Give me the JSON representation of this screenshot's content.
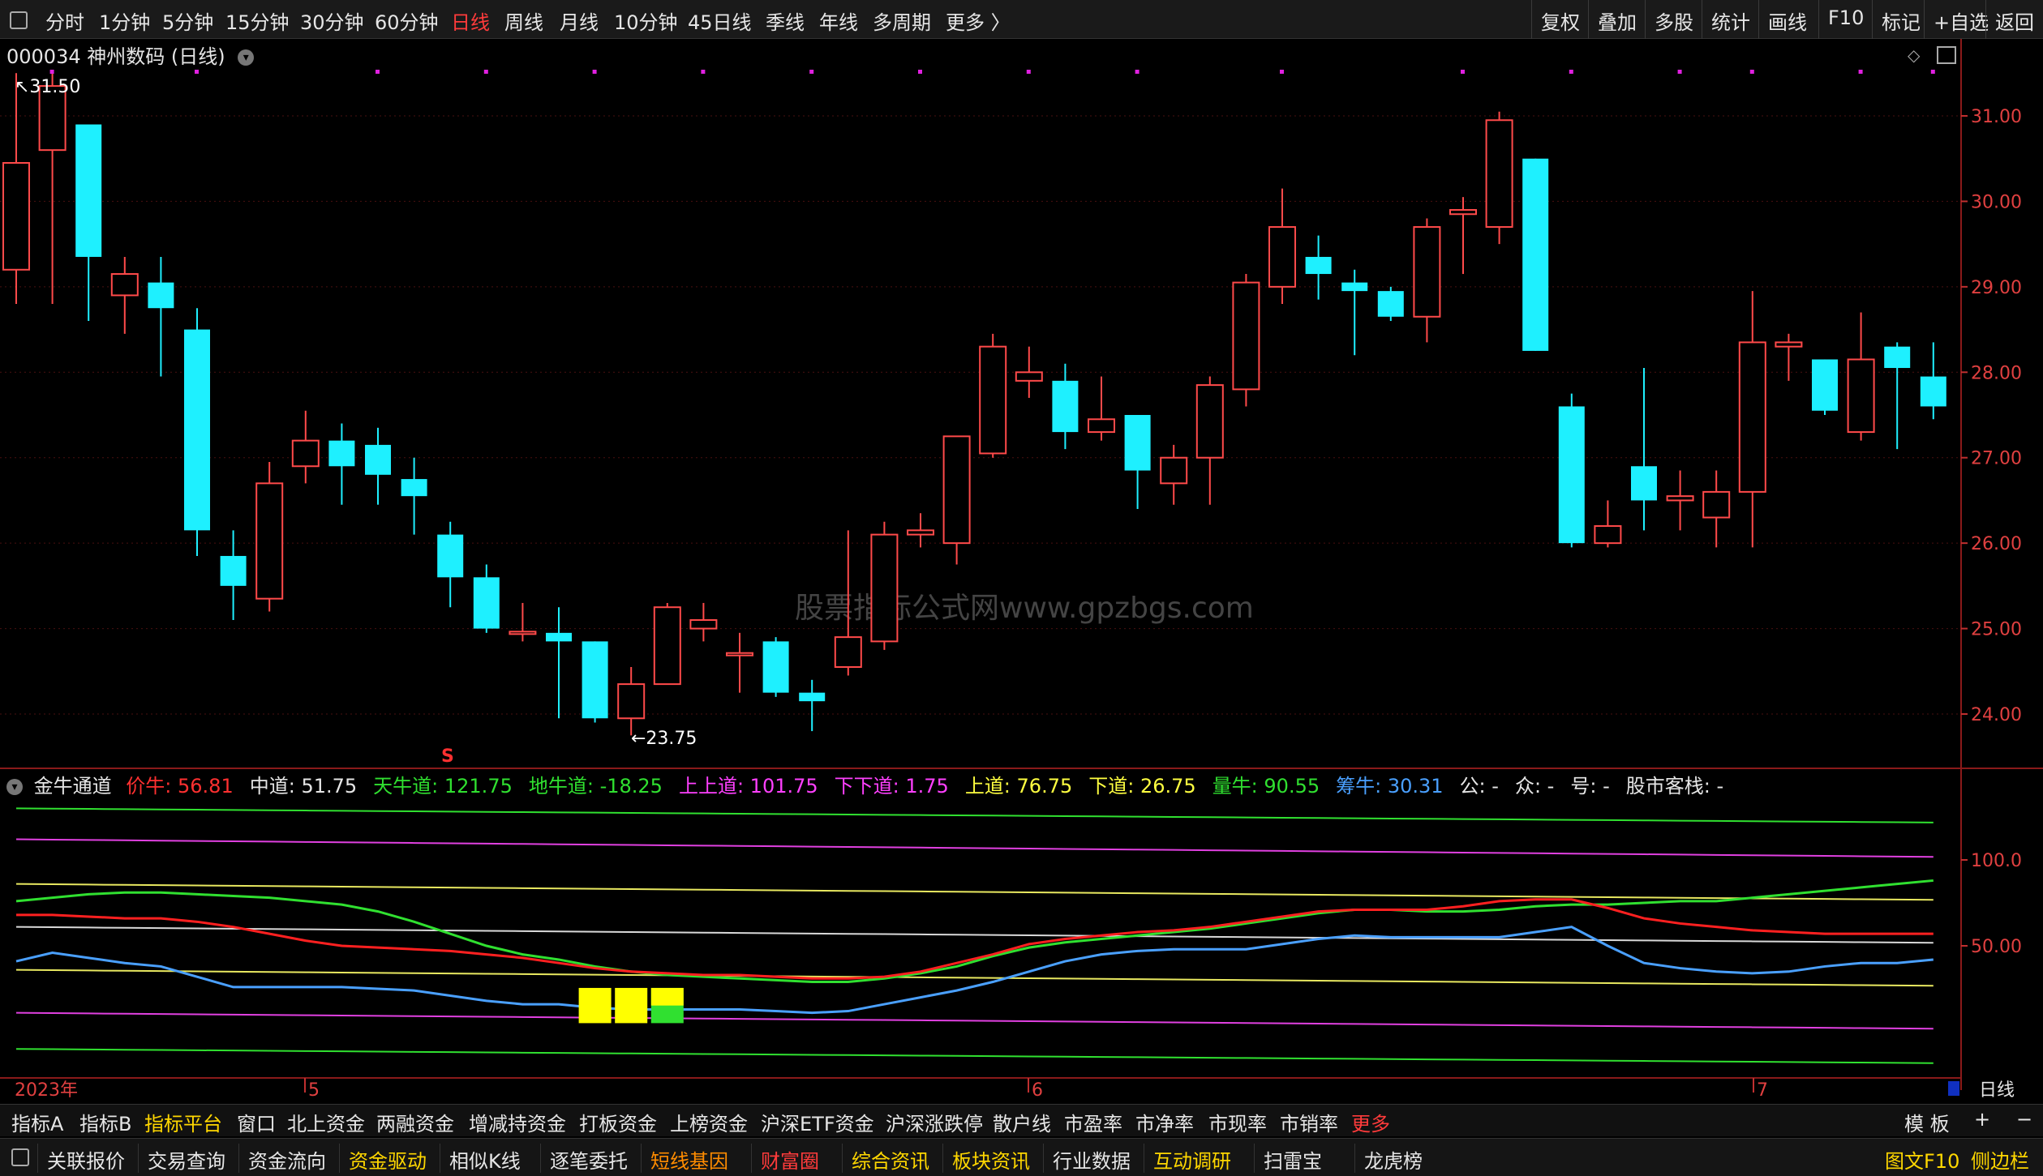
{
  "toolbar": {
    "periods": [
      "分时",
      "1分钟",
      "5分钟",
      "15分钟",
      "30分钟",
      "60分钟",
      "日线",
      "周线",
      "月线",
      "10分钟",
      "45日线",
      "季线",
      "年线",
      "多周期",
      "更多 〉"
    ],
    "active": "日线",
    "right": [
      "复权",
      "叠加",
      "多股",
      "统计",
      "画线",
      "F10",
      "标记",
      "+自选",
      "返回"
    ]
  },
  "stock": {
    "code": "000034",
    "name": "神州数码",
    "period": "(日线)"
  },
  "price_axis": [
    "31.00",
    "30.00",
    "29.00",
    "28.00",
    "27.00",
    "26.00",
    "25.00",
    "24.00"
  ],
  "marks": {
    "high": "31.50",
    "low": "23.75",
    "signal": "S"
  },
  "candles": [
    {
      "o": 29.2,
      "c": 30.45,
      "h": 31.5,
      "l": 28.8
    },
    {
      "o": 30.6,
      "c": 31.35,
      "h": 31.5,
      "l": 28.8
    },
    {
      "o": 30.9,
      "c": 29.35,
      "h": 29.6,
      "l": 28.6
    },
    {
      "o": 28.9,
      "c": 29.15,
      "h": 29.35,
      "l": 28.45
    },
    {
      "o": 29.05,
      "c": 28.75,
      "h": 29.35,
      "l": 27.95
    },
    {
      "o": 28.5,
      "c": 26.15,
      "h": 28.75,
      "l": 25.85
    },
    {
      "o": 25.85,
      "c": 25.5,
      "h": 26.15,
      "l": 25.1
    },
    {
      "o": 25.35,
      "c": 26.7,
      "h": 26.95,
      "l": 25.2
    },
    {
      "o": 26.9,
      "c": 27.2,
      "h": 27.55,
      "l": 26.7
    },
    {
      "o": 27.2,
      "c": 26.9,
      "h": 27.4,
      "l": 26.45
    },
    {
      "o": 27.15,
      "c": 26.8,
      "h": 27.35,
      "l": 26.45
    },
    {
      "o": 26.75,
      "c": 26.55,
      "h": 27.0,
      "l": 26.1
    },
    {
      "o": 26.1,
      "c": 25.6,
      "h": 26.25,
      "l": 25.25
    },
    {
      "o": 25.6,
      "c": 25.0,
      "h": 25.75,
      "l": 24.95
    },
    {
      "o": 24.95,
      "c": 24.95,
      "h": 25.3,
      "l": 24.85
    },
    {
      "o": 24.95,
      "c": 24.85,
      "h": 25.25,
      "l": 23.95
    },
    {
      "o": 24.85,
      "c": 23.95,
      "h": 24.85,
      "l": 23.9
    },
    {
      "o": 23.95,
      "c": 24.35,
      "h": 24.55,
      "l": 23.75
    },
    {
      "o": 24.35,
      "c": 25.25,
      "h": 25.3,
      "l": 24.35
    },
    {
      "o": 25.0,
      "c": 25.1,
      "h": 25.3,
      "l": 24.85
    },
    {
      "o": 24.7,
      "c": 24.7,
      "h": 24.95,
      "l": 24.25
    },
    {
      "o": 24.85,
      "c": 24.25,
      "h": 24.9,
      "l": 24.2
    },
    {
      "o": 24.25,
      "c": 24.15,
      "h": 24.4,
      "l": 23.8
    },
    {
      "o": 24.55,
      "c": 24.9,
      "h": 26.15,
      "l": 24.45
    },
    {
      "o": 24.85,
      "c": 26.1,
      "h": 26.25,
      "l": 24.75
    },
    {
      "o": 26.1,
      "c": 26.15,
      "h": 26.35,
      "l": 25.95
    },
    {
      "o": 26.0,
      "c": 27.25,
      "h": 27.25,
      "l": 25.75
    },
    {
      "o": 27.05,
      "c": 28.3,
      "h": 28.45,
      "l": 27.0
    },
    {
      "o": 27.9,
      "c": 28.0,
      "h": 28.3,
      "l": 27.7
    },
    {
      "o": 27.9,
      "c": 27.3,
      "h": 28.1,
      "l": 27.1
    },
    {
      "o": 27.3,
      "c": 27.45,
      "h": 27.95,
      "l": 27.2
    },
    {
      "o": 27.5,
      "c": 26.85,
      "h": 27.5,
      "l": 26.4
    },
    {
      "o": 26.7,
      "c": 27.0,
      "h": 27.15,
      "l": 26.45
    },
    {
      "o": 27.0,
      "c": 27.85,
      "h": 27.95,
      "l": 26.45
    },
    {
      "o": 27.8,
      "c": 29.05,
      "h": 29.15,
      "l": 27.6
    },
    {
      "o": 29.0,
      "c": 29.7,
      "h": 30.15,
      "l": 28.8
    },
    {
      "o": 29.35,
      "c": 29.15,
      "h": 29.6,
      "l": 28.85
    },
    {
      "o": 29.05,
      "c": 28.95,
      "h": 29.2,
      "l": 28.2
    },
    {
      "o": 28.95,
      "c": 28.65,
      "h": 29.0,
      "l": 28.6
    },
    {
      "o": 28.65,
      "c": 29.7,
      "h": 29.8,
      "l": 28.35
    },
    {
      "o": 29.85,
      "c": 29.9,
      "h": 30.05,
      "l": 29.15
    },
    {
      "o": 29.7,
      "c": 30.95,
      "h": 31.05,
      "l": 29.5
    },
    {
      "o": 30.5,
      "c": 28.25,
      "h": 30.5,
      "l": 28.25
    },
    {
      "o": 27.6,
      "c": 26.0,
      "h": 27.75,
      "l": 25.95
    },
    {
      "o": 26.0,
      "c": 26.2,
      "h": 26.5,
      "l": 25.95
    },
    {
      "o": 26.9,
      "c": 26.5,
      "h": 28.05,
      "l": 26.15
    },
    {
      "o": 26.5,
      "c": 26.55,
      "h": 26.85,
      "l": 26.15
    },
    {
      "o": 26.3,
      "c": 26.6,
      "h": 26.85,
      "l": 25.95
    },
    {
      "o": 26.6,
      "c": 28.35,
      "h": 28.95,
      "l": 25.95
    },
    {
      "o": 28.3,
      "c": 28.35,
      "h": 28.45,
      "l": 27.9
    },
    {
      "o": 28.15,
      "c": 27.55,
      "h": 28.15,
      "l": 27.5
    },
    {
      "o": 27.3,
      "c": 28.15,
      "h": 28.7,
      "l": 27.2
    },
    {
      "o": 28.3,
      "c": 28.05,
      "h": 28.35,
      "l": 27.1
    },
    {
      "o": 27.95,
      "c": 27.6,
      "h": 28.35,
      "l": 27.45
    }
  ],
  "indicator": {
    "name": "金牛通道",
    "items": [
      {
        "label": "价牛: ",
        "value": "56.81",
        "color": "#ff3030"
      },
      {
        "label": "中道: ",
        "value": "51.75",
        "color": "#e6e6e6"
      },
      {
        "label": "天牛道: ",
        "value": "121.75",
        "color": "#30e030"
      },
      {
        "label": "地牛道: ",
        "value": "-18.25",
        "color": "#30e030"
      },
      {
        "label": "上上道: ",
        "value": "101.75",
        "color": "#ff40ff"
      },
      {
        "label": "下下道: ",
        "value": "1.75",
        "color": "#ff40ff"
      },
      {
        "label": "上道: ",
        "value": "76.75",
        "color": "#ffff40"
      },
      {
        "label": "下道: ",
        "value": "26.75",
        "color": "#ffff40"
      },
      {
        "label": "量牛: ",
        "value": "90.55",
        "color": "#30e030"
      },
      {
        "label": "筹牛: ",
        "value": "30.31",
        "color": "#4aa0ff"
      },
      {
        "label": "公: ",
        "value": "-",
        "color": "#e6e6e6"
      },
      {
        "label": "众: ",
        "value": "-",
        "color": "#e6e6e6"
      },
      {
        "label": "号: ",
        "value": "-",
        "color": "#e6e6e6"
      },
      {
        "label": "股市客栈: ",
        "value": "-",
        "color": "#e6e6e6"
      }
    ],
    "axis": [
      "100.0",
      "50.00"
    ]
  },
  "date_axis": {
    "year": "2023年",
    "months": [
      "5",
      "6",
      "7"
    ],
    "period_btn": "日线"
  },
  "tabs1": [
    "指标A",
    "指标B",
    "指标平台",
    "窗口",
    "北上资金",
    "两融资金",
    "增减持资金",
    "打板资金",
    "上榜资金",
    "沪深ETF资金",
    "沪深涨跌停",
    "散户线",
    "市盈率",
    "市净率",
    "市现率",
    "市销率",
    "更多"
  ],
  "tabs1_right": [
    "模 板",
    "+",
    "−"
  ],
  "tabs2": [
    "关联报价",
    "交易查询",
    "资金流向",
    "资金驱动",
    "相似K线",
    "逐笔委托",
    "短线基因",
    "财富圈",
    "综合资讯",
    "板块资讯",
    "行业数据",
    "互动调研",
    "扫雷宝",
    "龙虎榜"
  ],
  "tabs2_right": [
    "图文F10",
    "侧边栏"
  ],
  "watermark": "股票指标公式网www.gpzbgs.com"
}
